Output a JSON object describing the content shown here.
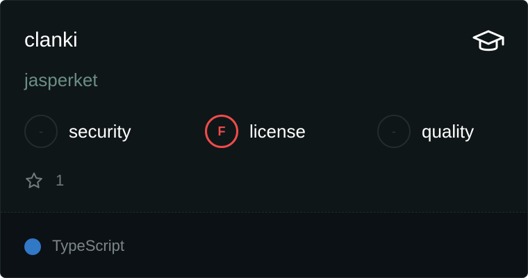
{
  "repo": {
    "name": "clanki",
    "owner": "jasperket",
    "stars": "1",
    "language": "TypeScript",
    "language_color": "#3178c6"
  },
  "header": {
    "badge_icon": "graduation-cap-icon"
  },
  "metrics": [
    {
      "label": "security",
      "grade": "-",
      "status": "neutral"
    },
    {
      "label": "license",
      "grade": "F",
      "status": "fail",
      "color": "#f04b4b"
    },
    {
      "label": "quality",
      "grade": "-",
      "status": "neutral"
    }
  ],
  "icons": {
    "stars": "star-icon"
  }
}
